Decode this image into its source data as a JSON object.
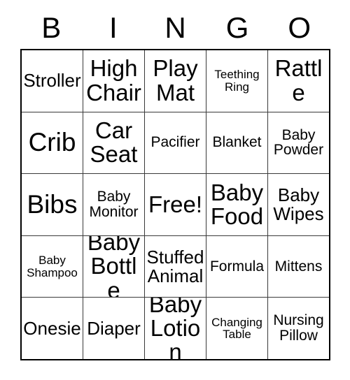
{
  "header": {
    "letters": [
      "B",
      "I",
      "N",
      "G",
      "O"
    ]
  },
  "grid": {
    "rows": [
      {
        "cells": [
          {
            "label": "Stroller",
            "size": "sz-md"
          },
          {
            "label": "High Chair",
            "size": "sz-lg"
          },
          {
            "label": "Play Mat",
            "size": "sz-lg"
          },
          {
            "label": "Teething Ring",
            "size": "sz-xs"
          },
          {
            "label": "Rattle",
            "size": "sz-lg"
          }
        ]
      },
      {
        "cells": [
          {
            "label": "Crib",
            "size": "sz-xl"
          },
          {
            "label": "Car Seat",
            "size": "sz-lg"
          },
          {
            "label": "Pacifier",
            "size": "sz-sm"
          },
          {
            "label": "Blanket",
            "size": "sz-sm"
          },
          {
            "label": "Baby Powder",
            "size": "sz-sm"
          }
        ]
      },
      {
        "cells": [
          {
            "label": "Bibs",
            "size": "sz-xl"
          },
          {
            "label": "Baby Monitor",
            "size": "sz-sm"
          },
          {
            "label": "Free!",
            "size": "sz-lg"
          },
          {
            "label": "Baby Food",
            "size": "sz-lg"
          },
          {
            "label": "Baby Wipes",
            "size": "sz-md"
          }
        ]
      },
      {
        "cells": [
          {
            "label": "Baby Shampoo",
            "size": "sz-xs"
          },
          {
            "label": "Baby Bottle",
            "size": "sz-lg"
          },
          {
            "label": "Stuffed Animal",
            "size": "sz-md"
          },
          {
            "label": "Formula",
            "size": "sz-sm"
          },
          {
            "label": "Mittens",
            "size": "sz-sm"
          }
        ]
      },
      {
        "cells": [
          {
            "label": "Onesie",
            "size": "sz-md"
          },
          {
            "label": "Diaper",
            "size": "sz-md"
          },
          {
            "label": "Baby Lotion",
            "size": "sz-lg"
          },
          {
            "label": "Changing Table",
            "size": "sz-xs"
          },
          {
            "label": "Nursing Pillow",
            "size": "sz-sm"
          }
        ]
      }
    ]
  },
  "colors": {
    "page_background": "#ffffff",
    "cell_background": "#ffffff",
    "text": "#000000",
    "outer_border": "#000000",
    "inner_border": "#3a3a3a"
  }
}
